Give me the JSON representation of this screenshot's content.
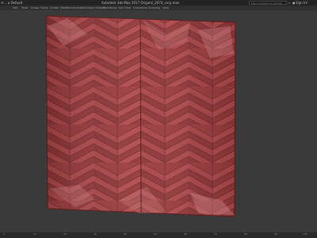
{
  "app": {
    "workspace_label": "...a Default",
    "window_title": "Autodesk 3ds Max 2017    Origami_2074_corp.max",
    "search_placeholder": "Type a keyword or phrase",
    "sign_in": "Sign In"
  },
  "menu": {
    "items": [
      "Edit",
      "Tools",
      "Group",
      "Views",
      "Create",
      "Modifiers",
      "Animation",
      "Graph Editors",
      "Rendering",
      "Civil View",
      "Customize",
      "Scripting",
      "Help"
    ]
  },
  "timeline": {
    "ticks": [
      "0",
      "10",
      "20",
      "30",
      "40",
      "50",
      "60",
      "70",
      "80",
      "90",
      "100"
    ]
  },
  "colors": {
    "panel_base": "#9a3b3d",
    "panel_edge": "#5e2022",
    "viewport_bg": "#3a3a3a"
  },
  "icons": [
    "menu-icon",
    "search-icon",
    "user-icon",
    "help-icon"
  ]
}
